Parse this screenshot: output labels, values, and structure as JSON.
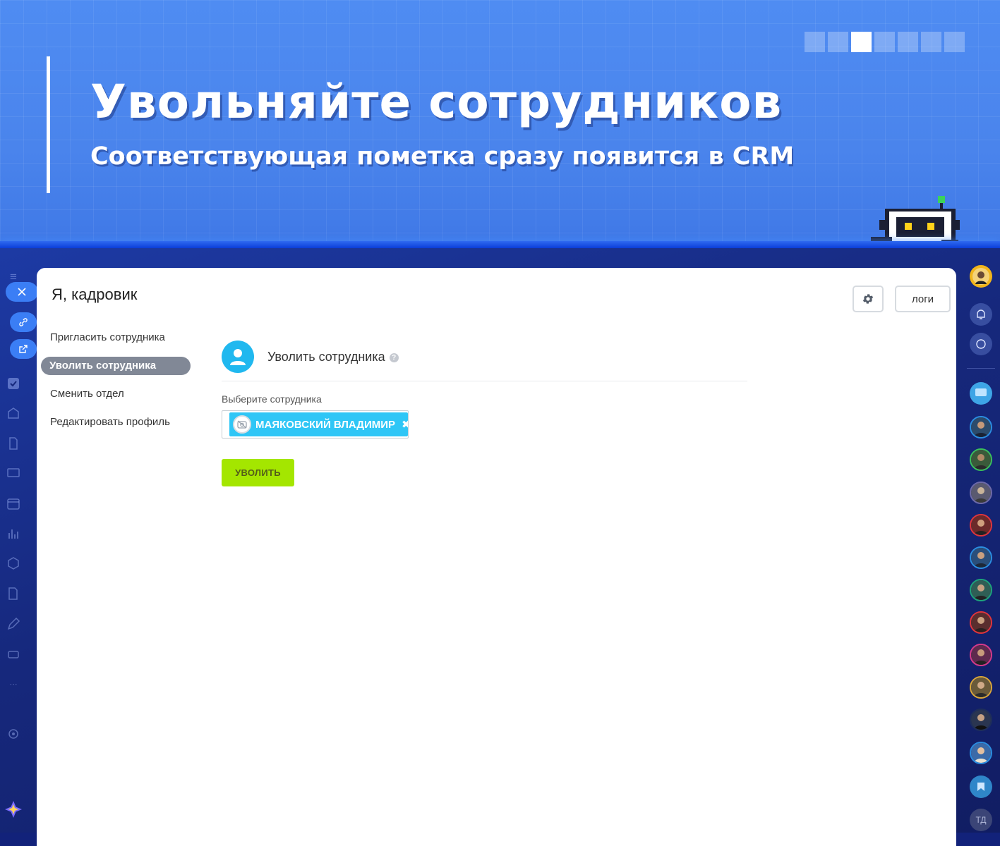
{
  "banner": {
    "title": "Увольняйте сотрудников",
    "subtitle": "Соответствующая пометка сразу появится в CRM",
    "slides_total": 7,
    "active_slide": 3
  },
  "modal": {
    "title": "Я, кадровик",
    "settings_icon": "gear-icon",
    "logs_label": "логи",
    "menu": [
      {
        "label": "Пригласить сотрудника",
        "active": false
      },
      {
        "label": "Уволить сотрудника",
        "active": true
      },
      {
        "label": "Сменить отдел",
        "active": false
      },
      {
        "label": "Редактировать профиль",
        "active": false
      }
    ],
    "section_title": "Уволить сотрудника",
    "help_mark": "?",
    "field_label": "Выберите сотрудника",
    "selected_employee": "МАЯКОВСКИЙ ВЛАДИМИР",
    "chip_remove": "✖",
    "fire_button": "УВОЛИТЬ"
  },
  "right_rail": {
    "initials_avatar": "ТД"
  },
  "colors": {
    "banner_bg": "#4a86ee",
    "accent_blue": "#2fc6f6",
    "fire_button": "#a4e600",
    "active_menu": "#818896"
  }
}
